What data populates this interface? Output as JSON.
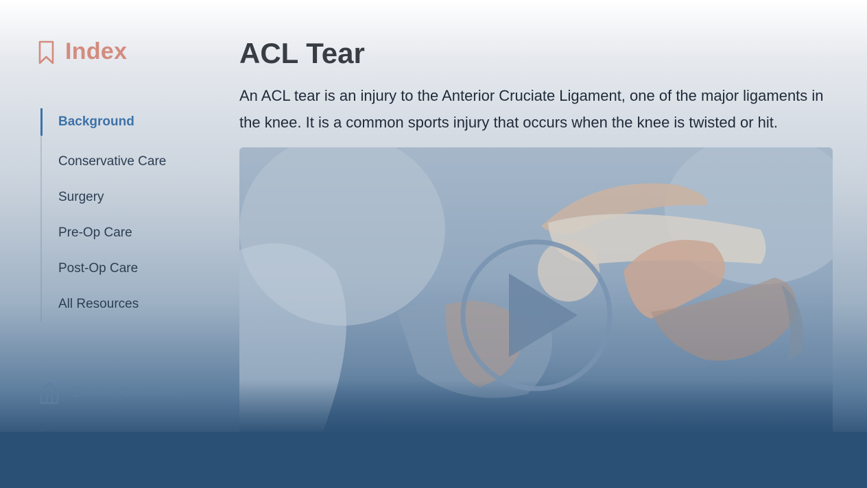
{
  "sidebar": {
    "index_title": "Index",
    "items": [
      {
        "label": "Background",
        "active": true
      },
      {
        "label": "Conservative Care",
        "active": false
      },
      {
        "label": "Surgery",
        "active": false
      },
      {
        "label": "Pre-Op Care",
        "active": false
      },
      {
        "label": "Post-Op Care",
        "active": false
      },
      {
        "label": "All Resources",
        "active": false
      }
    ],
    "back_label": "Back to Conditions"
  },
  "main": {
    "title": "ACL Tear",
    "description": "An ACL tear is an injury to the Anterior Cruciate Ligament, one of the major ligaments in the knee. It is a common sports injury that occurs when the knee is twisted or hit."
  },
  "icons": {
    "index": "bookmark-icon",
    "back": "home-icon",
    "video": "play-icon"
  },
  "colors": {
    "index_accent": "#d38c7e",
    "active_nav": "#3d72a8",
    "title_text": "#383d44",
    "bottom_band": "#2b5075"
  }
}
